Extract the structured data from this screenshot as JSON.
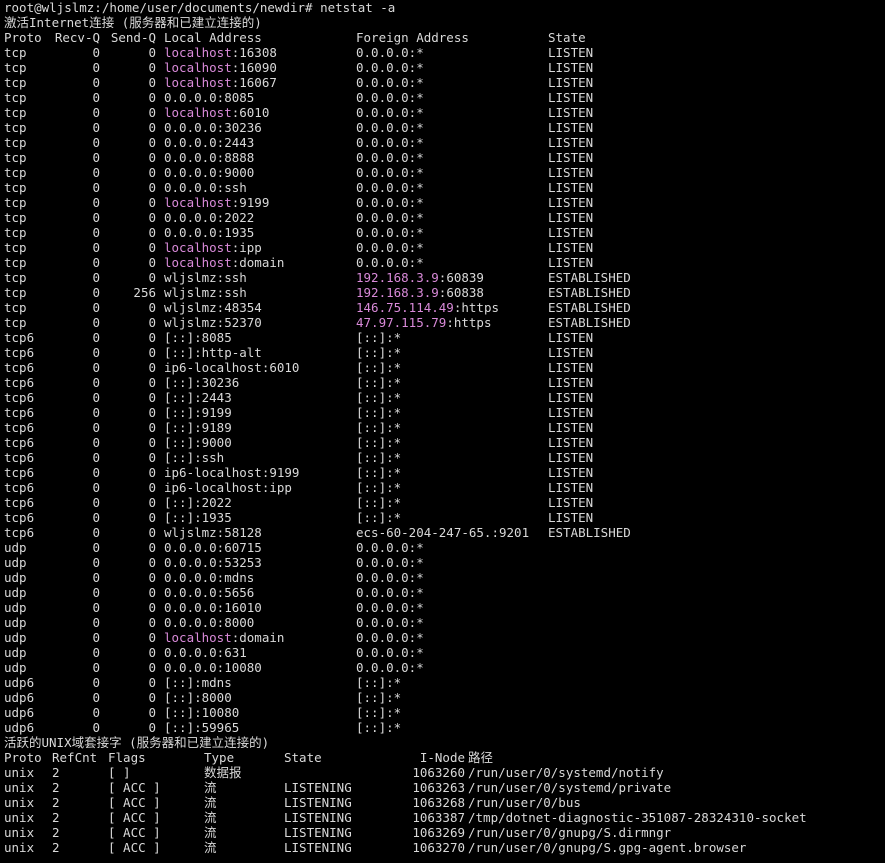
{
  "prompt": "root@wljslmz:/home/user/documents/newdir# netstat -a",
  "inet_title": "激活Internet连接 (服务器和已建立连接的)",
  "inet_header": {
    "proto": "Proto",
    "recvq": "Recv-Q",
    "sendq": "Send-Q",
    "local": "Local Address",
    "foreign": "Foreign Address",
    "state": "State"
  },
  "inet_rows": [
    {
      "proto": "tcp",
      "recv": "0",
      "send": "0",
      "local_hl": "localhost",
      "local_rest": ":16308",
      "foreign_hl": "",
      "foreign_rest": "0.0.0.0:*",
      "state": "LISTEN"
    },
    {
      "proto": "tcp",
      "recv": "0",
      "send": "0",
      "local_hl": "localhost",
      "local_rest": ":16090",
      "foreign_hl": "",
      "foreign_rest": "0.0.0.0:*",
      "state": "LISTEN"
    },
    {
      "proto": "tcp",
      "recv": "0",
      "send": "0",
      "local_hl": "localhost",
      "local_rest": ":16067",
      "foreign_hl": "",
      "foreign_rest": "0.0.0.0:*",
      "state": "LISTEN"
    },
    {
      "proto": "tcp",
      "recv": "0",
      "send": "0",
      "local_hl": "",
      "local_rest": "0.0.0.0:8085",
      "foreign_hl": "",
      "foreign_rest": "0.0.0.0:*",
      "state": "LISTEN"
    },
    {
      "proto": "tcp",
      "recv": "0",
      "send": "0",
      "local_hl": "localhost",
      "local_rest": ":6010",
      "foreign_hl": "",
      "foreign_rest": "0.0.0.0:*",
      "state": "LISTEN"
    },
    {
      "proto": "tcp",
      "recv": "0",
      "send": "0",
      "local_hl": "",
      "local_rest": "0.0.0.0:30236",
      "foreign_hl": "",
      "foreign_rest": "0.0.0.0:*",
      "state": "LISTEN"
    },
    {
      "proto": "tcp",
      "recv": "0",
      "send": "0",
      "local_hl": "",
      "local_rest": "0.0.0.0:2443",
      "foreign_hl": "",
      "foreign_rest": "0.0.0.0:*",
      "state": "LISTEN"
    },
    {
      "proto": "tcp",
      "recv": "0",
      "send": "0",
      "local_hl": "",
      "local_rest": "0.0.0.0:8888",
      "foreign_hl": "",
      "foreign_rest": "0.0.0.0:*",
      "state": "LISTEN"
    },
    {
      "proto": "tcp",
      "recv": "0",
      "send": "0",
      "local_hl": "",
      "local_rest": "0.0.0.0:9000",
      "foreign_hl": "",
      "foreign_rest": "0.0.0.0:*",
      "state": "LISTEN"
    },
    {
      "proto": "tcp",
      "recv": "0",
      "send": "0",
      "local_hl": "",
      "local_rest": "0.0.0.0:ssh",
      "foreign_hl": "",
      "foreign_rest": "0.0.0.0:*",
      "state": "LISTEN"
    },
    {
      "proto": "tcp",
      "recv": "0",
      "send": "0",
      "local_hl": "localhost",
      "local_rest": ":9199",
      "foreign_hl": "",
      "foreign_rest": "0.0.0.0:*",
      "state": "LISTEN"
    },
    {
      "proto": "tcp",
      "recv": "0",
      "send": "0",
      "local_hl": "",
      "local_rest": "0.0.0.0:2022",
      "foreign_hl": "",
      "foreign_rest": "0.0.0.0:*",
      "state": "LISTEN"
    },
    {
      "proto": "tcp",
      "recv": "0",
      "send": "0",
      "local_hl": "",
      "local_rest": "0.0.0.0:1935",
      "foreign_hl": "",
      "foreign_rest": "0.0.0.0:*",
      "state": "LISTEN"
    },
    {
      "proto": "tcp",
      "recv": "0",
      "send": "0",
      "local_hl": "localhost",
      "local_rest": ":ipp",
      "foreign_hl": "",
      "foreign_rest": "0.0.0.0:*",
      "state": "LISTEN"
    },
    {
      "proto": "tcp",
      "recv": "0",
      "send": "0",
      "local_hl": "localhost",
      "local_rest": ":domain",
      "foreign_hl": "",
      "foreign_rest": "0.0.0.0:*",
      "state": "LISTEN"
    },
    {
      "proto": "tcp",
      "recv": "0",
      "send": "0",
      "local_hl": "",
      "local_rest": "wljslmz:ssh",
      "foreign_hl": "192.168.3.9",
      "foreign_rest": ":60839",
      "state": "ESTABLISHED"
    },
    {
      "proto": "tcp",
      "recv": "0",
      "send": "256",
      "local_hl": "",
      "local_rest": "wljslmz:ssh",
      "foreign_hl": "192.168.3.9",
      "foreign_rest": ":60838",
      "state": "ESTABLISHED"
    },
    {
      "proto": "tcp",
      "recv": "0",
      "send": "0",
      "local_hl": "",
      "local_rest": "wljslmz:48354",
      "foreign_hl": "146.75.114.49",
      "foreign_rest": ":https",
      "state": "ESTABLISHED"
    },
    {
      "proto": "tcp",
      "recv": "0",
      "send": "0",
      "local_hl": "",
      "local_rest": "wljslmz:52370",
      "foreign_hl": "47.97.115.79",
      "foreign_rest": ":https",
      "state": "ESTABLISHED"
    },
    {
      "proto": "tcp6",
      "recv": "0",
      "send": "0",
      "local_hl": "",
      "local_rest": "[::]:8085",
      "foreign_hl": "",
      "foreign_rest": "[::]:*",
      "state": "LISTEN"
    },
    {
      "proto": "tcp6",
      "recv": "0",
      "send": "0",
      "local_hl": "",
      "local_rest": "[::]:http-alt",
      "foreign_hl": "",
      "foreign_rest": "[::]:*",
      "state": "LISTEN"
    },
    {
      "proto": "tcp6",
      "recv": "0",
      "send": "0",
      "local_hl": "",
      "local_rest": "ip6-localhost:6010",
      "foreign_hl": "",
      "foreign_rest": "[::]:*",
      "state": "LISTEN"
    },
    {
      "proto": "tcp6",
      "recv": "0",
      "send": "0",
      "local_hl": "",
      "local_rest": "[::]:30236",
      "foreign_hl": "",
      "foreign_rest": "[::]:*",
      "state": "LISTEN"
    },
    {
      "proto": "tcp6",
      "recv": "0",
      "send": "0",
      "local_hl": "",
      "local_rest": "[::]:2443",
      "foreign_hl": "",
      "foreign_rest": "[::]:*",
      "state": "LISTEN"
    },
    {
      "proto": "tcp6",
      "recv": "0",
      "send": "0",
      "local_hl": "",
      "local_rest": "[::]:9199",
      "foreign_hl": "",
      "foreign_rest": "[::]:*",
      "state": "LISTEN"
    },
    {
      "proto": "tcp6",
      "recv": "0",
      "send": "0",
      "local_hl": "",
      "local_rest": "[::]:9189",
      "foreign_hl": "",
      "foreign_rest": "[::]:*",
      "state": "LISTEN"
    },
    {
      "proto": "tcp6",
      "recv": "0",
      "send": "0",
      "local_hl": "",
      "local_rest": "[::]:9000",
      "foreign_hl": "",
      "foreign_rest": "[::]:*",
      "state": "LISTEN"
    },
    {
      "proto": "tcp6",
      "recv": "0",
      "send": "0",
      "local_hl": "",
      "local_rest": "[::]:ssh",
      "foreign_hl": "",
      "foreign_rest": "[::]:*",
      "state": "LISTEN"
    },
    {
      "proto": "tcp6",
      "recv": "0",
      "send": "0",
      "local_hl": "",
      "local_rest": "ip6-localhost:9199",
      "foreign_hl": "",
      "foreign_rest": "[::]:*",
      "state": "LISTEN"
    },
    {
      "proto": "tcp6",
      "recv": "0",
      "send": "0",
      "local_hl": "",
      "local_rest": "ip6-localhost:ipp",
      "foreign_hl": "",
      "foreign_rest": "[::]:*",
      "state": "LISTEN"
    },
    {
      "proto": "tcp6",
      "recv": "0",
      "send": "0",
      "local_hl": "",
      "local_rest": "[::]:2022",
      "foreign_hl": "",
      "foreign_rest": "[::]:*",
      "state": "LISTEN"
    },
    {
      "proto": "tcp6",
      "recv": "0",
      "send": "0",
      "local_hl": "",
      "local_rest": "[::]:1935",
      "foreign_hl": "",
      "foreign_rest": "[::]:*",
      "state": "LISTEN"
    },
    {
      "proto": "tcp6",
      "recv": "0",
      "send": "0",
      "local_hl": "",
      "local_rest": "wljslmz:58128",
      "foreign_hl": "",
      "foreign_rest": "ecs-60-204-247-65.:9201",
      "state": "ESTABLISHED"
    },
    {
      "proto": "udp",
      "recv": "0",
      "send": "0",
      "local_hl": "",
      "local_rest": "0.0.0.0:60715",
      "foreign_hl": "",
      "foreign_rest": "0.0.0.0:*",
      "state": ""
    },
    {
      "proto": "udp",
      "recv": "0",
      "send": "0",
      "local_hl": "",
      "local_rest": "0.0.0.0:53253",
      "foreign_hl": "",
      "foreign_rest": "0.0.0.0:*",
      "state": ""
    },
    {
      "proto": "udp",
      "recv": "0",
      "send": "0",
      "local_hl": "",
      "local_rest": "0.0.0.0:mdns",
      "foreign_hl": "",
      "foreign_rest": "0.0.0.0:*",
      "state": ""
    },
    {
      "proto": "udp",
      "recv": "0",
      "send": "0",
      "local_hl": "",
      "local_rest": "0.0.0.0:5656",
      "foreign_hl": "",
      "foreign_rest": "0.0.0.0:*",
      "state": ""
    },
    {
      "proto": "udp",
      "recv": "0",
      "send": "0",
      "local_hl": "",
      "local_rest": "0.0.0.0:16010",
      "foreign_hl": "",
      "foreign_rest": "0.0.0.0:*",
      "state": ""
    },
    {
      "proto": "udp",
      "recv": "0",
      "send": "0",
      "local_hl": "",
      "local_rest": "0.0.0.0:8000",
      "foreign_hl": "",
      "foreign_rest": "0.0.0.0:*",
      "state": ""
    },
    {
      "proto": "udp",
      "recv": "0",
      "send": "0",
      "local_hl": "localhost",
      "local_rest": ":domain",
      "foreign_hl": "",
      "foreign_rest": "0.0.0.0:*",
      "state": ""
    },
    {
      "proto": "udp",
      "recv": "0",
      "send": "0",
      "local_hl": "",
      "local_rest": "0.0.0.0:631",
      "foreign_hl": "",
      "foreign_rest": "0.0.0.0:*",
      "state": ""
    },
    {
      "proto": "udp",
      "recv": "0",
      "send": "0",
      "local_hl": "",
      "local_rest": "0.0.0.0:10080",
      "foreign_hl": "",
      "foreign_rest": "0.0.0.0:*",
      "state": ""
    },
    {
      "proto": "udp6",
      "recv": "0",
      "send": "0",
      "local_hl": "",
      "local_rest": "[::]:mdns",
      "foreign_hl": "",
      "foreign_rest": "[::]:*",
      "state": ""
    },
    {
      "proto": "udp6",
      "recv": "0",
      "send": "0",
      "local_hl": "",
      "local_rest": "[::]:8000",
      "foreign_hl": "",
      "foreign_rest": "[::]:*",
      "state": ""
    },
    {
      "proto": "udp6",
      "recv": "0",
      "send": "0",
      "local_hl": "",
      "local_rest": "[::]:10080",
      "foreign_hl": "",
      "foreign_rest": "[::]:*",
      "state": ""
    },
    {
      "proto": "udp6",
      "recv": "0",
      "send": "0",
      "local_hl": "",
      "local_rest": "[::]:59965",
      "foreign_hl": "",
      "foreign_rest": "[::]:*",
      "state": ""
    }
  ],
  "unix_title": "活跃的UNIX域套接字 (服务器和已建立连接的)",
  "unix_header": {
    "proto": "Proto",
    "refcnt": "RefCnt",
    "flags": "Flags",
    "type": "Type",
    "state": "State",
    "inode": "I-Node",
    "path": "路径"
  },
  "unix_rows": [
    {
      "proto": "unix",
      "refcnt": "2",
      "flags": "[ ]",
      "type": "数据报",
      "state": "",
      "inode": "1063260",
      "path": "/run/user/0/systemd/notify"
    },
    {
      "proto": "unix",
      "refcnt": "2",
      "flags": "[ ACC ]",
      "type": "流",
      "state": "LISTENING",
      "inode": "1063263",
      "path": "/run/user/0/systemd/private"
    },
    {
      "proto": "unix",
      "refcnt": "2",
      "flags": "[ ACC ]",
      "type": "流",
      "state": "LISTENING",
      "inode": "1063268",
      "path": "/run/user/0/bus"
    },
    {
      "proto": "unix",
      "refcnt": "2",
      "flags": "[ ACC ]",
      "type": "流",
      "state": "LISTENING",
      "inode": "1063387",
      "path": "/tmp/dotnet-diagnostic-351087-28324310-socket"
    },
    {
      "proto": "unix",
      "refcnt": "2",
      "flags": "[ ACC ]",
      "type": "流",
      "state": "LISTENING",
      "inode": "1063269",
      "path": "/run/user/0/gnupg/S.dirmngr"
    },
    {
      "proto": "unix",
      "refcnt": "2",
      "flags": "[ ACC ]",
      "type": "流",
      "state": "LISTENING",
      "inode": "1063270",
      "path": "/run/user/0/gnupg/S.gpg-agent.browser"
    }
  ],
  "colors": {
    "background": "#000000",
    "text": "#d9d9d9",
    "host_highlight": "#d98ad9"
  }
}
